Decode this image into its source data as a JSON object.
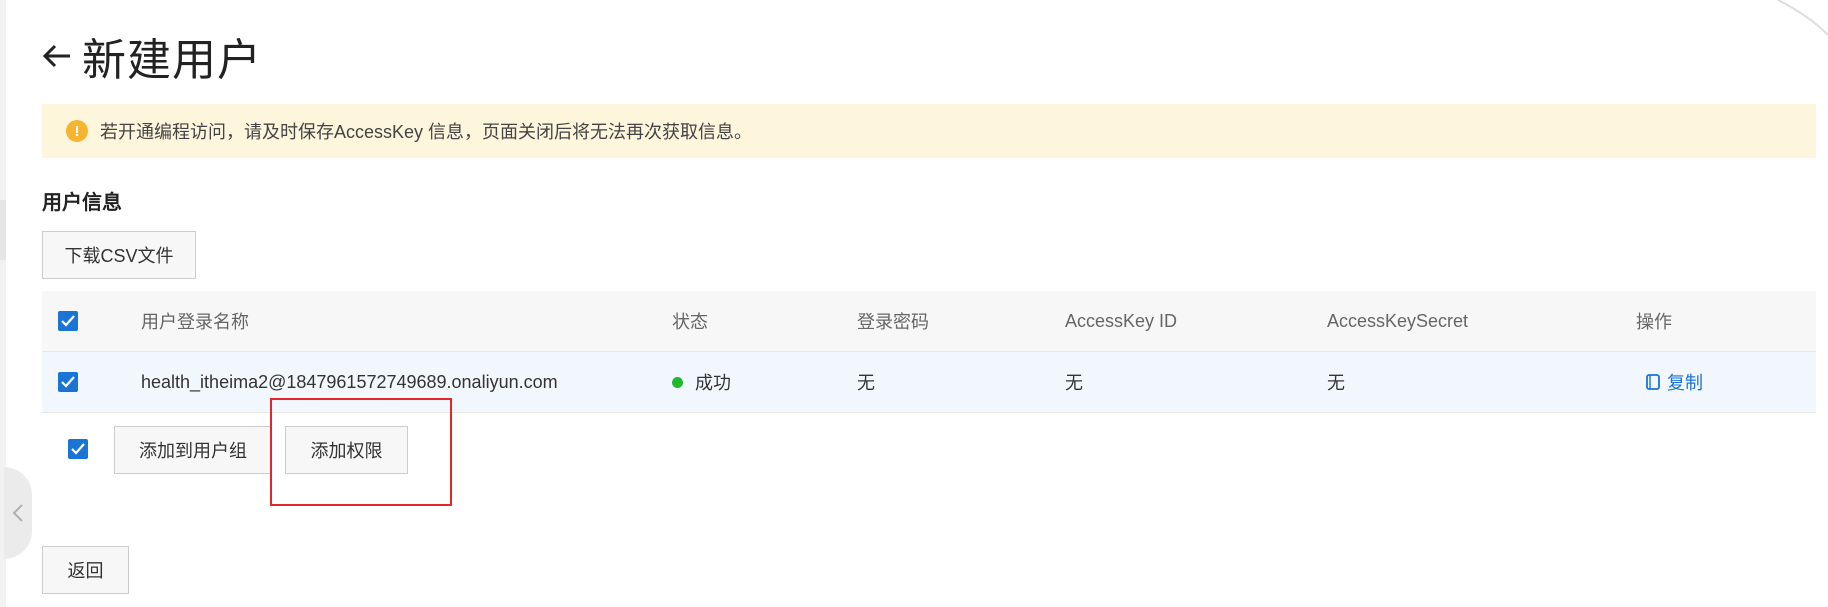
{
  "header": {
    "back_icon": "arrow-left-icon",
    "title": "新建用户"
  },
  "alert": {
    "icon": "warning-icon",
    "icon_glyph": "!",
    "text": "若开通编程访问，请及时保存AccessKey 信息，页面关闭后将无法再次获取信息。",
    "background": "#fdf5dc",
    "icon_color": "#f5b530"
  },
  "section": {
    "title": "用户信息",
    "download_csv_label": "下载CSV文件"
  },
  "table": {
    "columns": {
      "login_name": "用户登录名称",
      "status": "状态",
      "password": "登录密码",
      "access_key_id": "AccessKey ID",
      "access_key_secret": "AccessKeySecret",
      "actions": "操作"
    },
    "header_checked": true,
    "rows": [
      {
        "checked": true,
        "login_name": "health_itheima2@1847961572749689.onaliyun.com",
        "status": "成功",
        "status_color": "#1fb82e",
        "password": "无",
        "access_key_id": "无",
        "access_key_secret": "无",
        "action_label": "复制",
        "action_icon": "copy-icon"
      }
    ]
  },
  "actions": {
    "checked": true,
    "add_to_group_label": "添加到用户组",
    "add_permission_label": "添加权限"
  },
  "footer": {
    "back_label": "返回"
  },
  "sidebar": {
    "collapse_icon": "chevron-left-icon"
  },
  "colors": {
    "accent": "#1a74d4",
    "highlight_border": "#e3262a",
    "row_selected_bg": "#f2f7fd"
  }
}
